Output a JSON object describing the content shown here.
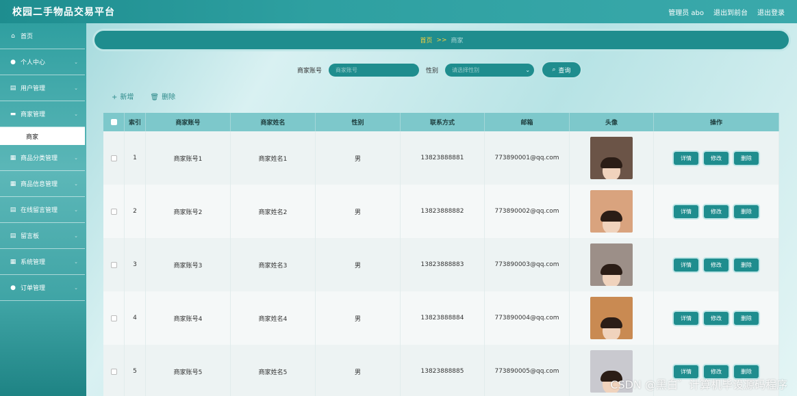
{
  "header": {
    "title": "校园二手物品交易平台",
    "user_label": "管理员 abo",
    "front_label": "退出到前台",
    "logout_label": "退出登录"
  },
  "sidebar": {
    "items": [
      {
        "label": "首页",
        "icon": "home-icon",
        "glyph": "⌂"
      },
      {
        "label": "个人中心",
        "icon": "user-icon",
        "glyph": "●"
      },
      {
        "label": "用户管理",
        "icon": "document-icon",
        "glyph": "▤"
      },
      {
        "label": "商家管理",
        "icon": "chat-icon",
        "glyph": "▬"
      },
      {
        "label": "商家",
        "sub": true
      },
      {
        "label": "商品分类管理",
        "icon": "grid-icon",
        "glyph": "▦"
      },
      {
        "label": "商品信息管理",
        "icon": "grid-icon",
        "glyph": "▦"
      },
      {
        "label": "在线留言管理",
        "icon": "document-icon",
        "glyph": "▤"
      },
      {
        "label": "留言板",
        "icon": "document-icon",
        "glyph": "▤"
      },
      {
        "label": "系统管理",
        "icon": "grid-icon",
        "glyph": "▦"
      },
      {
        "label": "订单管理",
        "icon": "user-icon",
        "glyph": "●"
      }
    ]
  },
  "breadcrumb": {
    "home": "首页",
    "sep": ">>",
    "current": "商家"
  },
  "search": {
    "account_label": "商家账号",
    "account_placeholder": "商家账号",
    "gender_label": "性别",
    "gender_placeholder": "请选择性别",
    "query_label": "查询"
  },
  "actions": {
    "add_label": "新增",
    "delete_label": "删除"
  },
  "table": {
    "headers": [
      "索引",
      "商家账号",
      "商家姓名",
      "性别",
      "联系方式",
      "邮箱",
      "头像",
      "操作"
    ],
    "rows": [
      {
        "index": "1",
        "account": "商家账号1",
        "name": "商家姓名1",
        "gender": "男",
        "phone": "13823888881",
        "email": "773890001@qq.com",
        "avatar_bg": "#6b5447"
      },
      {
        "index": "2",
        "account": "商家账号2",
        "name": "商家姓名2",
        "gender": "男",
        "phone": "13823888882",
        "email": "773890002@qq.com",
        "avatar_bg": "#d9a37e"
      },
      {
        "index": "3",
        "account": "商家账号3",
        "name": "商家姓名3",
        "gender": "男",
        "phone": "13823888883",
        "email": "773890003@qq.com",
        "avatar_bg": "#9c8f88"
      },
      {
        "index": "4",
        "account": "商家账号4",
        "name": "商家姓名4",
        "gender": "男",
        "phone": "13823888884",
        "email": "773890004@qq.com",
        "avatar_bg": "#c98a52"
      },
      {
        "index": "5",
        "account": "商家账号5",
        "name": "商家姓名5",
        "gender": "男",
        "phone": "13823888885",
        "email": "773890005@qq.com",
        "avatar_bg": "#c9c9cf"
      }
    ],
    "row_buttons": {
      "detail": "详情",
      "edit": "修改",
      "delete": "删除"
    }
  },
  "watermark": "CSDN @黑白゛计算机毕设源码程序"
}
